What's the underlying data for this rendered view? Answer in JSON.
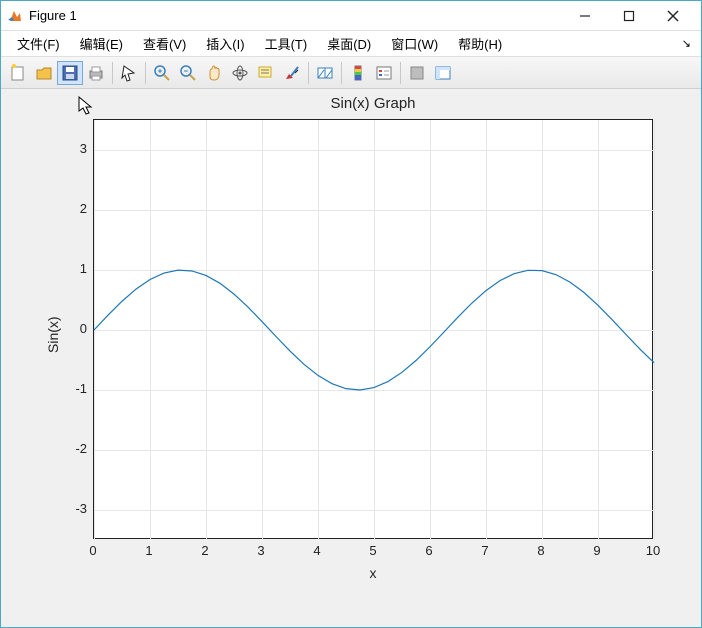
{
  "window": {
    "title": "Figure 1"
  },
  "menu": {
    "file": "文件(F)",
    "edit": "编辑(E)",
    "view": "查看(V)",
    "insert": "插入(I)",
    "tools": "工具(T)",
    "desktop": "桌面(D)",
    "window": "窗口(W)",
    "help": "帮助(H)"
  },
  "chart_data": {
    "type": "line",
    "title": "Sin(x) Graph",
    "xlabel": "x",
    "ylabel": "Sin(x)",
    "xlim": [
      0,
      10
    ],
    "ylim": [
      -3.5,
      3.5
    ],
    "xticks": [
      0,
      1,
      2,
      3,
      4,
      5,
      6,
      7,
      8,
      9,
      10
    ],
    "yticks": [
      -3,
      -2,
      -1,
      0,
      1,
      2,
      3
    ],
    "x": [
      0,
      0.25,
      0.5,
      0.75,
      1,
      1.25,
      1.5,
      1.75,
      2,
      2.25,
      2.5,
      2.75,
      3,
      3.25,
      3.5,
      3.75,
      4,
      4.25,
      4.5,
      4.75,
      5,
      5.25,
      5.5,
      5.75,
      6,
      6.25,
      6.5,
      6.75,
      7,
      7.25,
      7.5,
      7.75,
      8,
      8.25,
      8.5,
      8.75,
      9,
      9.25,
      9.5,
      9.75,
      10
    ],
    "y": [
      0,
      0.2474,
      0.4794,
      0.6816,
      0.8415,
      0.949,
      0.9975,
      0.9839,
      0.9093,
      0.7781,
      0.5985,
      0.3817,
      0.1411,
      -0.1082,
      -0.3508,
      -0.5716,
      -0.7568,
      -0.895,
      -0.9775,
      -0.9993,
      -0.9589,
      -0.8589,
      -0.7055,
      -0.5083,
      -0.2794,
      -0.0332,
      0.2151,
      0.45,
      0.657,
      0.8231,
      0.938,
      0.9946,
      0.9894,
      0.9226,
      0.7985,
      0.6247,
      0.4121,
      0.174,
      -0.0752,
      -0.3195,
      -0.544
    ]
  }
}
